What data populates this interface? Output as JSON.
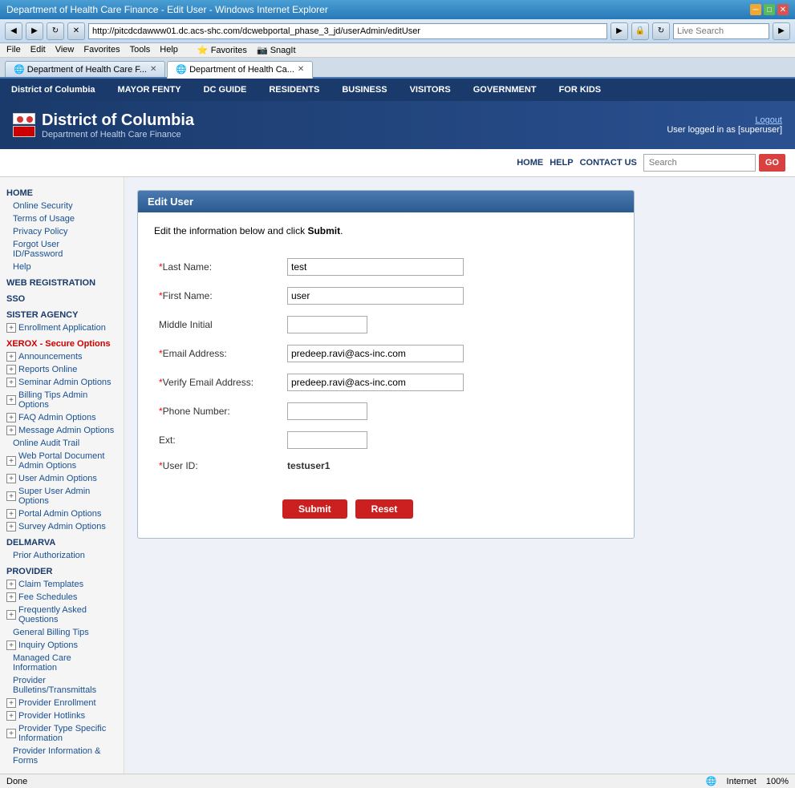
{
  "browser": {
    "title": "Department of Health Care Finance - Edit User - Windows Internet Explorer",
    "address": "http://pitcdcdawww01.dc.acs-shc.com/dcwebportal_phase_3_jd/userAdmin/editUser",
    "search_placeholder": "Live Search",
    "tabs": [
      {
        "label": "Department of Health Care F...",
        "active": false
      },
      {
        "label": "Department of Health Ca...",
        "active": true
      }
    ],
    "menu": [
      "File",
      "Edit",
      "View",
      "Favorites",
      "Tools",
      "Help"
    ],
    "favorites_label": "Favorites",
    "snagit_label": "SnagIt"
  },
  "dc_nav": {
    "items": [
      {
        "label": "District of Columbia"
      },
      {
        "label": "MAYOR FENTY"
      },
      {
        "label": "DC GUIDE"
      },
      {
        "label": "RESIDENTS"
      },
      {
        "label": "BUSINESS"
      },
      {
        "label": "VISITORS"
      },
      {
        "label": "GOVERNMENT"
      },
      {
        "label": "FOR KIDS"
      }
    ]
  },
  "header": {
    "site_title": "District of Columbia",
    "dept_name": "Department of Health Care Finance",
    "logout_label": "Logout",
    "user_label": "User logged in as [superuser]"
  },
  "top_nav": {
    "links": [
      "HOME",
      "HELP",
      "CONTACT US"
    ],
    "search_placeholder": "Search",
    "go_label": "GO"
  },
  "sidebar": {
    "sections": [
      {
        "title": "HOME",
        "links": [
          "Online Security",
          "Terms of Usage",
          "Privacy Policy",
          "Forgot User ID/Password",
          "Help"
        ]
      },
      {
        "title": "WEB REGISTRATION",
        "links": []
      },
      {
        "title": "SSO",
        "links": []
      },
      {
        "title": "SISTER AGENCY",
        "expandable": [
          "Enrollment Application"
        ]
      },
      {
        "title": "XEROX - Secure Options",
        "title_class": "red",
        "expandable": [
          "Announcements",
          "Reports Online",
          "Seminar Admin Options",
          "Billing Tips Admin Options",
          "FAQ Admin Options",
          "Message Admin Options",
          "Online Audit Trail",
          "Web Portal Document Admin Options",
          "User Admin Options",
          "Super User Admin Options",
          "Portal Admin Options",
          "Survey Admin Options"
        ]
      },
      {
        "title": "DELMARVA",
        "links": [
          "Prior Authorization"
        ]
      },
      {
        "title": "PROVIDER",
        "expandable": [
          "Claim Templates",
          "Fee Schedules",
          "Frequently Asked Questions",
          "General Billing Tips",
          "Inquiry Options",
          "Managed Care Information",
          "Provider Bulletins/Transmittals",
          "Provider Enrollment",
          "Provider Hotlinks",
          "Provider Type Specific Information",
          "Provider Information & Forms"
        ]
      }
    ]
  },
  "form": {
    "panel_title": "Edit User",
    "instruction": "Edit the information below and click",
    "instruction_link": "Submit",
    "fields": [
      {
        "label": "Last Name:",
        "required": true,
        "value": "test",
        "type": "input",
        "name": "last-name"
      },
      {
        "label": "First Name:",
        "required": true,
        "value": "user",
        "type": "input",
        "name": "first-name"
      },
      {
        "label": "Middle Initial",
        "required": false,
        "value": "",
        "type": "input-sm",
        "name": "middle-initial"
      },
      {
        "label": "Email Address:",
        "required": true,
        "value": "predeep.ravi@acs-inc.com",
        "type": "input",
        "name": "email"
      },
      {
        "label": "Verify Email Address:",
        "required": true,
        "value": "predeep.ravi@acs-inc.com",
        "type": "input",
        "name": "verify-email"
      },
      {
        "label": "Phone Number:",
        "required": true,
        "value": "",
        "type": "input-sm",
        "name": "phone"
      },
      {
        "label": "Ext:",
        "required": false,
        "value": "",
        "type": "input-sm",
        "name": "ext"
      },
      {
        "label": "User ID:",
        "required": true,
        "value": "testuser1",
        "type": "static",
        "name": "user-id"
      }
    ],
    "submit_label": "Submit",
    "reset_label": "Reset"
  },
  "status_bar": {
    "left": "Done",
    "zone": "Internet",
    "zoom": "100%"
  }
}
